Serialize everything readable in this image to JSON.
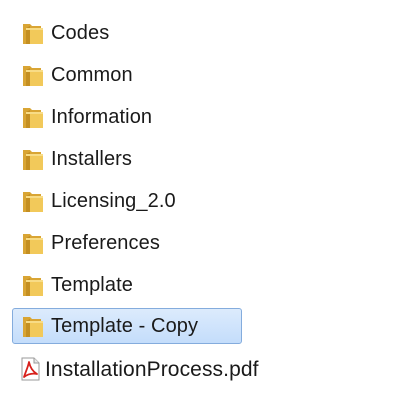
{
  "files": [
    {
      "label": "Codes",
      "icon": "folder-icon",
      "selected": false
    },
    {
      "label": "Common",
      "icon": "folder-icon",
      "selected": false
    },
    {
      "label": "Information",
      "icon": "folder-icon",
      "selected": false
    },
    {
      "label": "Installers",
      "icon": "folder-icon",
      "selected": false
    },
    {
      "label": "Licensing_2.0",
      "icon": "folder-icon",
      "selected": false
    },
    {
      "label": "Preferences",
      "icon": "folder-icon",
      "selected": false
    },
    {
      "label": "Template",
      "icon": "folder-icon",
      "selected": false
    },
    {
      "label": "Template - Copy",
      "icon": "folder-icon",
      "selected": true
    },
    {
      "label": "InstallationProcess.pdf",
      "icon": "pdf-file-icon",
      "selected": false
    }
  ],
  "colors": {
    "folder": "#e8b84a",
    "folder_shade": "#c99524",
    "selection_fill": "#cfe3fc",
    "selection_border": "#84acdd",
    "pdf_red": "#d7201c"
  }
}
